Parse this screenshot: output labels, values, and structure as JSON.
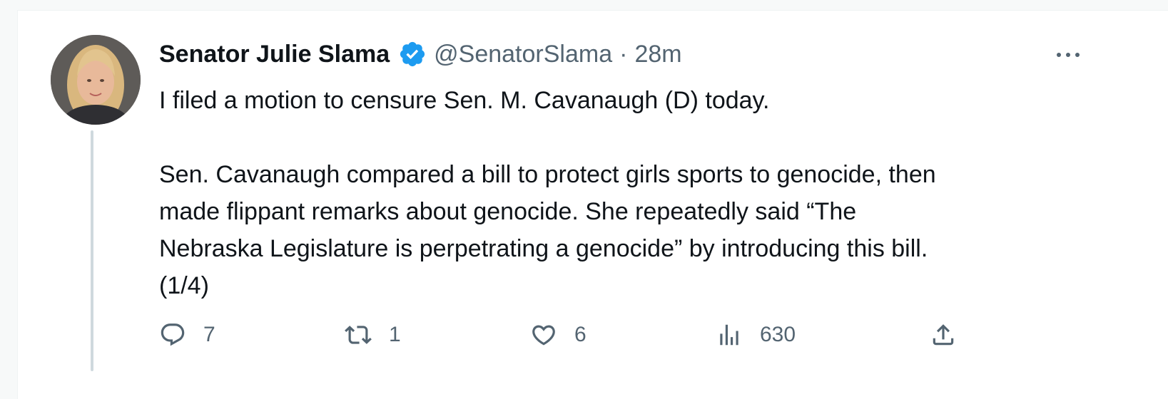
{
  "tweet": {
    "display_name": "Senator Julie Slama",
    "verified": true,
    "handle": "@SenatorSlama",
    "separator": "·",
    "time": "28m",
    "text": "I filed a motion to censure Sen. M. Cavanaugh (D) today.\n\nSen. Cavanaugh compared a bill to protect girls sports to genocide, then\nmade flippant remarks about genocide. She repeatedly said “The\nNebraska Legislature is perpetrating a genocide” by introducing this bill.\n(1/4)"
  },
  "actions": {
    "replies": "7",
    "retweets": "1",
    "likes": "6",
    "views": "630"
  },
  "icons": {
    "avatar": "profile-photo",
    "verified": "verified-badge-icon",
    "more": "more-horizontal-icon",
    "reply": "reply-icon",
    "retweet": "retweet-icon",
    "like": "heart-icon",
    "views": "analytics-icon",
    "share": "share-icon"
  },
  "colors": {
    "verified_blue": "#1d9bf0",
    "text_primary": "#0f1419",
    "text_secondary": "#536471",
    "thread_line": "#cfd9de"
  }
}
